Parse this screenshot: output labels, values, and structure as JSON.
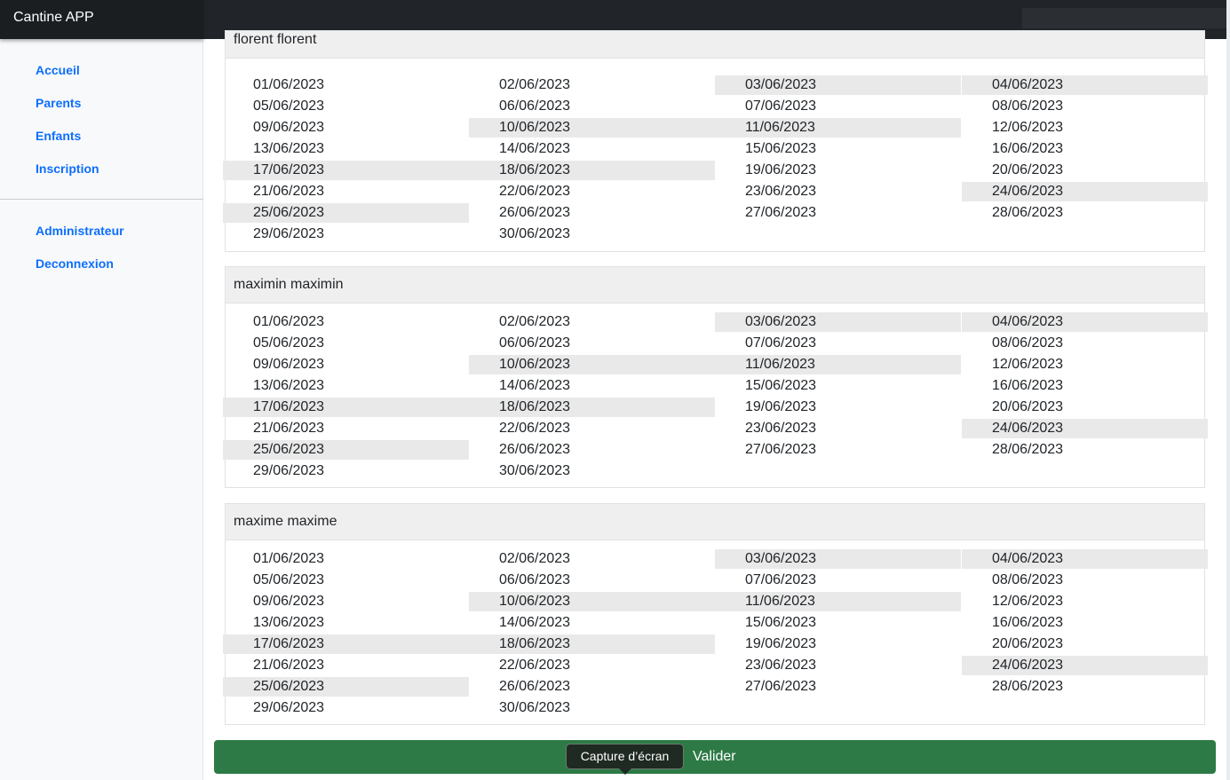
{
  "app": {
    "brand": "Cantine APP"
  },
  "sidebar": {
    "items": [
      {
        "label": "Accueil"
      },
      {
        "label": "Parents"
      },
      {
        "label": "Enfants"
      },
      {
        "label": "Inscription"
      },
      {
        "label": "Administrateur"
      },
      {
        "label": "Deconnexion"
      }
    ]
  },
  "colors": {
    "highlight": "#e9e9e9",
    "accent": "#2d7a46",
    "link": "#0d6efd"
  },
  "children": [
    {
      "name": "florent florent",
      "dates": [
        "01/06/2023",
        "02/06/2023",
        "03/06/2023",
        "04/06/2023",
        "05/06/2023",
        "06/06/2023",
        "07/06/2023",
        "08/06/2023",
        "09/06/2023",
        "10/06/2023",
        "11/06/2023",
        "12/06/2023",
        "13/06/2023",
        "14/06/2023",
        "15/06/2023",
        "16/06/2023",
        "17/06/2023",
        "18/06/2023",
        "19/06/2023",
        "20/06/2023",
        "21/06/2023",
        "22/06/2023",
        "23/06/2023",
        "24/06/2023",
        "25/06/2023",
        "26/06/2023",
        "27/06/2023",
        "28/06/2023",
        "29/06/2023",
        "30/06/2023"
      ],
      "highlighted": [
        "03/06/2023",
        "04/06/2023",
        "10/06/2023",
        "11/06/2023",
        "17/06/2023",
        "18/06/2023",
        "24/06/2023",
        "25/06/2023"
      ]
    },
    {
      "name": "maximin maximin",
      "dates": [
        "01/06/2023",
        "02/06/2023",
        "03/06/2023",
        "04/06/2023",
        "05/06/2023",
        "06/06/2023",
        "07/06/2023",
        "08/06/2023",
        "09/06/2023",
        "10/06/2023",
        "11/06/2023",
        "12/06/2023",
        "13/06/2023",
        "14/06/2023",
        "15/06/2023",
        "16/06/2023",
        "17/06/2023",
        "18/06/2023",
        "19/06/2023",
        "20/06/2023",
        "21/06/2023",
        "22/06/2023",
        "23/06/2023",
        "24/06/2023",
        "25/06/2023",
        "26/06/2023",
        "27/06/2023",
        "28/06/2023",
        "29/06/2023",
        "30/06/2023"
      ],
      "highlighted": [
        "03/06/2023",
        "04/06/2023",
        "10/06/2023",
        "11/06/2023",
        "17/06/2023",
        "18/06/2023",
        "24/06/2023",
        "25/06/2023"
      ]
    },
    {
      "name": "maxime maxime",
      "dates": [
        "01/06/2023",
        "02/06/2023",
        "03/06/2023",
        "04/06/2023",
        "05/06/2023",
        "06/06/2023",
        "07/06/2023",
        "08/06/2023",
        "09/06/2023",
        "10/06/2023",
        "11/06/2023",
        "12/06/2023",
        "13/06/2023",
        "14/06/2023",
        "15/06/2023",
        "16/06/2023",
        "17/06/2023",
        "18/06/2023",
        "19/06/2023",
        "20/06/2023",
        "21/06/2023",
        "22/06/2023",
        "23/06/2023",
        "24/06/2023",
        "25/06/2023",
        "26/06/2023",
        "27/06/2023",
        "28/06/2023",
        "29/06/2023",
        "30/06/2023"
      ],
      "highlighted": [
        "03/06/2023",
        "04/06/2023",
        "10/06/2023",
        "11/06/2023",
        "17/06/2023",
        "18/06/2023",
        "24/06/2023",
        "25/06/2023"
      ]
    }
  ],
  "actions": {
    "submit_label": "Valider"
  },
  "tooltip": {
    "text": "Capture d’écran"
  }
}
